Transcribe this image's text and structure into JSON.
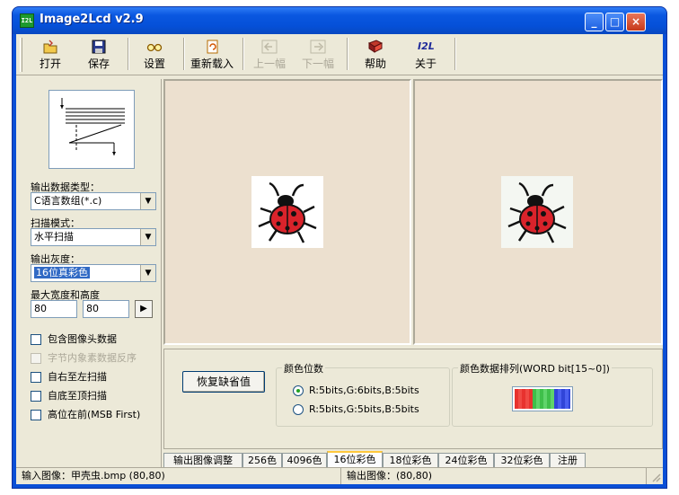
{
  "window": {
    "title": "Image2Lcd v2.9",
    "icon_text": "I2L"
  },
  "toolbar": {
    "open": "打开",
    "save": "保存",
    "settings": "设置",
    "reload": "重新载入",
    "prev": "上一幅",
    "next": "下一幅",
    "help": "帮助",
    "about": "关于",
    "about_icon_text": "I2L"
  },
  "left": {
    "output_type_label": "输出数据类型：",
    "output_type_value": "C语言数组(*.c)",
    "scan_mode_label": "扫描模式：",
    "scan_mode_value": "水平扫描",
    "gray_label": "输出灰度：",
    "gray_value": "16位真彩色",
    "max_size_label": "最大宽度和高度",
    "max_width": "80",
    "max_height": "80",
    "checks": {
      "header": "包含图像头数据",
      "reverse": "字节内象素数据反序",
      "right_to_left": "自右至左扫描",
      "bottom_to_top": "自底至顶扫描",
      "msb_first": "高位在前(MSB First)"
    }
  },
  "opts": {
    "restore": "恢复缺省值",
    "color_bits_title": "颜色位数",
    "radio1": "R:5bits,G:6bits,B:5bits",
    "radio2": "R:5bits,G:5bits,B:5bits",
    "order_title": "颜色数据排列(WORD bit[15~0])"
  },
  "tabs": [
    "输出图像调整",
    "256色",
    "4096色",
    "16位彩色",
    "18位彩色",
    "24位彩色",
    "32位彩色",
    "注册"
  ],
  "status": {
    "input": "输入图像：甲壳虫.bmp (80,80)",
    "output": "输出图像：(80,80)"
  },
  "colors": {
    "accent": "#0a4fd6",
    "selection": "#316ac5",
    "bug_red": "#d9232b"
  }
}
